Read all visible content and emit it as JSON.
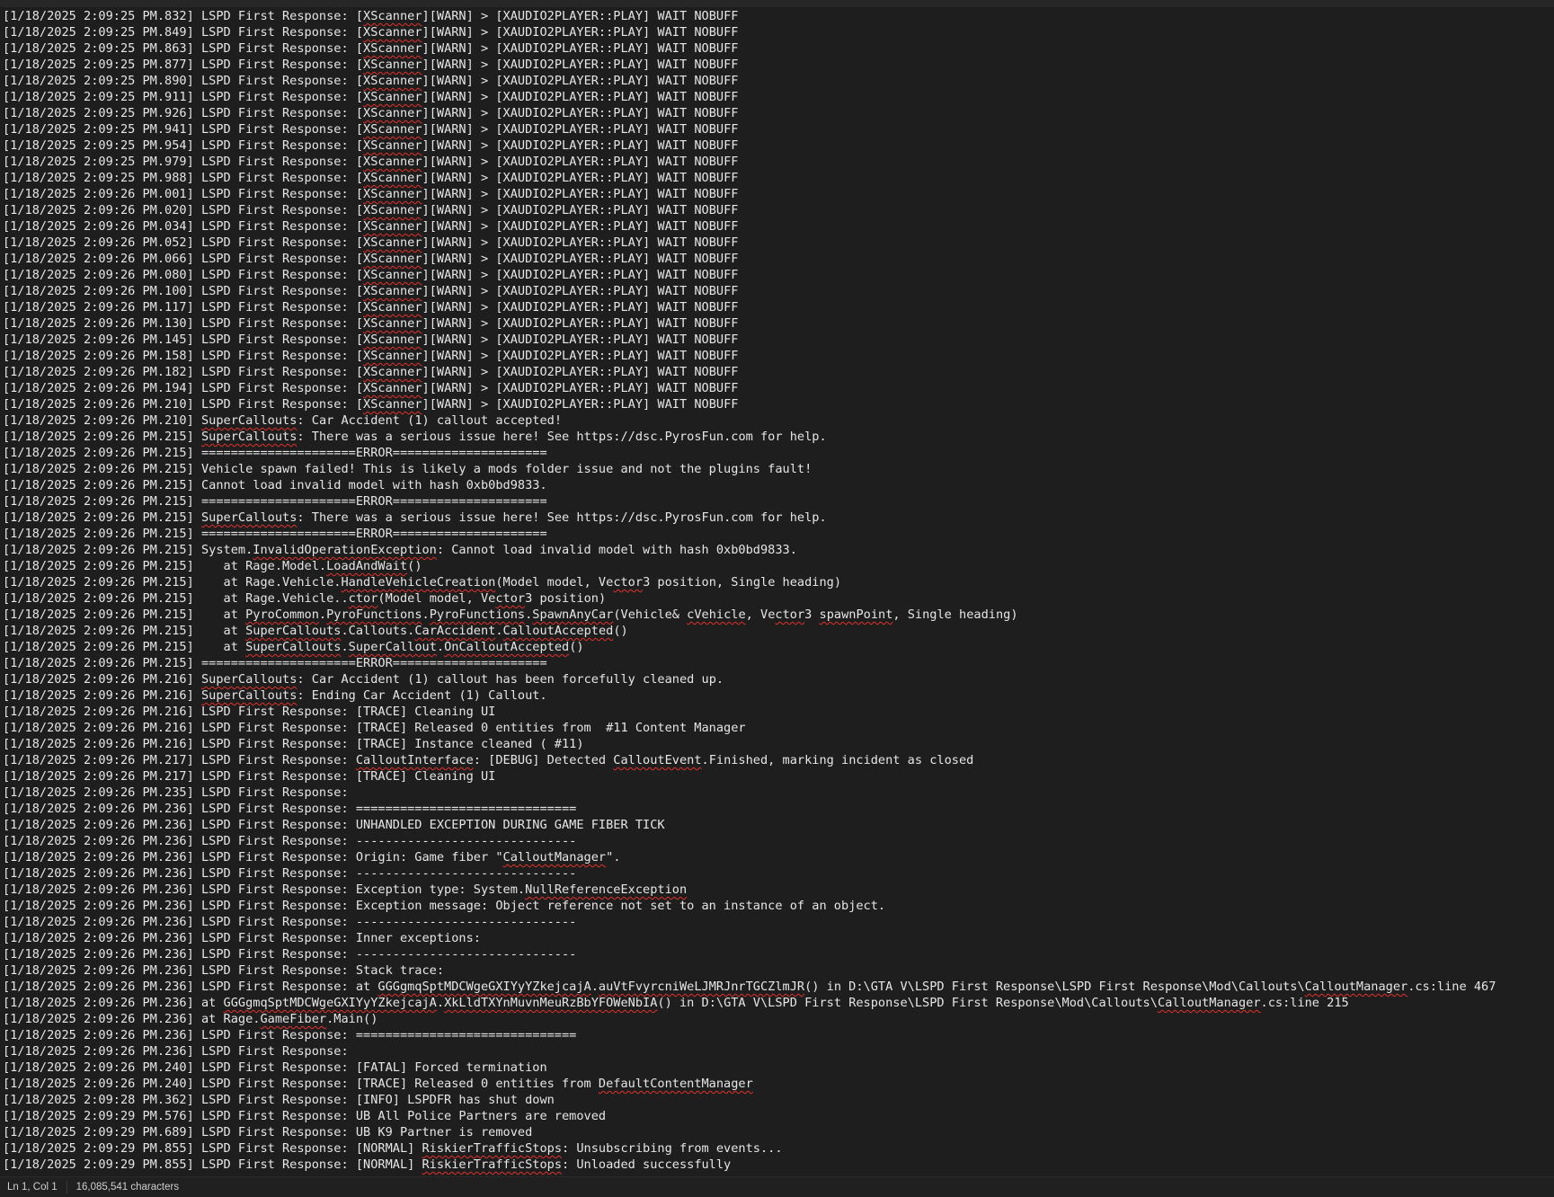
{
  "editor": {
    "lines": [
      "[1/18/2025 2:09:25 PM.832] LSPD First Response: [XScanner][WARN] > [XAUDIO2PLAYER::PLAY] WAIT NOBUFF",
      "[1/18/2025 2:09:25 PM.849] LSPD First Response: [XScanner][WARN] > [XAUDIO2PLAYER::PLAY] WAIT NOBUFF",
      "[1/18/2025 2:09:25 PM.863] LSPD First Response: [XScanner][WARN] > [XAUDIO2PLAYER::PLAY] WAIT NOBUFF",
      "[1/18/2025 2:09:25 PM.877] LSPD First Response: [XScanner][WARN] > [XAUDIO2PLAYER::PLAY] WAIT NOBUFF",
      "[1/18/2025 2:09:25 PM.890] LSPD First Response: [XScanner][WARN] > [XAUDIO2PLAYER::PLAY] WAIT NOBUFF",
      "[1/18/2025 2:09:25 PM.911] LSPD First Response: [XScanner][WARN] > [XAUDIO2PLAYER::PLAY] WAIT NOBUFF",
      "[1/18/2025 2:09:25 PM.926] LSPD First Response: [XScanner][WARN] > [XAUDIO2PLAYER::PLAY] WAIT NOBUFF",
      "[1/18/2025 2:09:25 PM.941] LSPD First Response: [XScanner][WARN] > [XAUDIO2PLAYER::PLAY] WAIT NOBUFF",
      "[1/18/2025 2:09:25 PM.954] LSPD First Response: [XScanner][WARN] > [XAUDIO2PLAYER::PLAY] WAIT NOBUFF",
      "[1/18/2025 2:09:25 PM.979] LSPD First Response: [XScanner][WARN] > [XAUDIO2PLAYER::PLAY] WAIT NOBUFF",
      "[1/18/2025 2:09:25 PM.988] LSPD First Response: [XScanner][WARN] > [XAUDIO2PLAYER::PLAY] WAIT NOBUFF",
      "[1/18/2025 2:09:26 PM.001] LSPD First Response: [XScanner][WARN] > [XAUDIO2PLAYER::PLAY] WAIT NOBUFF",
      "[1/18/2025 2:09:26 PM.020] LSPD First Response: [XScanner][WARN] > [XAUDIO2PLAYER::PLAY] WAIT NOBUFF",
      "[1/18/2025 2:09:26 PM.034] LSPD First Response: [XScanner][WARN] > [XAUDIO2PLAYER::PLAY] WAIT NOBUFF",
      "[1/18/2025 2:09:26 PM.052] LSPD First Response: [XScanner][WARN] > [XAUDIO2PLAYER::PLAY] WAIT NOBUFF",
      "[1/18/2025 2:09:26 PM.066] LSPD First Response: [XScanner][WARN] > [XAUDIO2PLAYER::PLAY] WAIT NOBUFF",
      "[1/18/2025 2:09:26 PM.080] LSPD First Response: [XScanner][WARN] > [XAUDIO2PLAYER::PLAY] WAIT NOBUFF",
      "[1/18/2025 2:09:26 PM.100] LSPD First Response: [XScanner][WARN] > [XAUDIO2PLAYER::PLAY] WAIT NOBUFF",
      "[1/18/2025 2:09:26 PM.117] LSPD First Response: [XScanner][WARN] > [XAUDIO2PLAYER::PLAY] WAIT NOBUFF",
      "[1/18/2025 2:09:26 PM.130] LSPD First Response: [XScanner][WARN] > [XAUDIO2PLAYER::PLAY] WAIT NOBUFF",
      "[1/18/2025 2:09:26 PM.145] LSPD First Response: [XScanner][WARN] > [XAUDIO2PLAYER::PLAY] WAIT NOBUFF",
      "[1/18/2025 2:09:26 PM.158] LSPD First Response: [XScanner][WARN] > [XAUDIO2PLAYER::PLAY] WAIT NOBUFF",
      "[1/18/2025 2:09:26 PM.182] LSPD First Response: [XScanner][WARN] > [XAUDIO2PLAYER::PLAY] WAIT NOBUFF",
      "[1/18/2025 2:09:26 PM.194] LSPD First Response: [XScanner][WARN] > [XAUDIO2PLAYER::PLAY] WAIT NOBUFF",
      "[1/18/2025 2:09:26 PM.210] LSPD First Response: [XScanner][WARN] > [XAUDIO2PLAYER::PLAY] WAIT NOBUFF",
      "[1/18/2025 2:09:26 PM.210] SuperCallouts: Car Accident (1) callout accepted!",
      "[1/18/2025 2:09:26 PM.215] SuperCallouts: There was a serious issue here! See https://dsc.PyrosFun.com for help.",
      "[1/18/2025 2:09:26 PM.215] =====================ERROR=====================",
      "[1/18/2025 2:09:26 PM.215] Vehicle spawn failed! This is likely a mods folder issue and not the plugins fault!",
      "[1/18/2025 2:09:26 PM.215] Cannot load invalid model with hash 0xb0bd9833.",
      "[1/18/2025 2:09:26 PM.215] =====================ERROR=====================",
      "[1/18/2025 2:09:26 PM.215] SuperCallouts: There was a serious issue here! See https://dsc.PyrosFun.com for help.",
      "[1/18/2025 2:09:26 PM.215] =====================ERROR=====================",
      "[1/18/2025 2:09:26 PM.215] System.InvalidOperationException: Cannot load invalid model with hash 0xb0bd9833.",
      "[1/18/2025 2:09:26 PM.215]    at Rage.Model.LoadAndWait()",
      "[1/18/2025 2:09:26 PM.215]    at Rage.Vehicle.HandleVehicleCreation(Model model, Vector3 position, Single heading)",
      "[1/18/2025 2:09:26 PM.215]    at Rage.Vehicle..ctor(Model model, Vector3 position)",
      "[1/18/2025 2:09:26 PM.215]    at PyroCommon.PyroFunctions.PyroFunctions.SpawnAnyCar(Vehicle& cVehicle, Vector3 spawnPoint, Single heading)",
      "[1/18/2025 2:09:26 PM.215]    at SuperCallouts.Callouts.CarAccident.CalloutAccepted()",
      "[1/18/2025 2:09:26 PM.215]    at SuperCallouts.SuperCallout.OnCalloutAccepted()",
      "[1/18/2025 2:09:26 PM.215] =====================ERROR=====================",
      "[1/18/2025 2:09:26 PM.216] SuperCallouts: Car Accident (1) callout has been forcefully cleaned up.",
      "[1/18/2025 2:09:26 PM.216] SuperCallouts: Ending Car Accident (1) Callout.",
      "[1/18/2025 2:09:26 PM.216] LSPD First Response: [TRACE] Cleaning UI",
      "[1/18/2025 2:09:26 PM.216] LSPD First Response: [TRACE] Released 0 entities from  #11 Content Manager",
      "[1/18/2025 2:09:26 PM.216] LSPD First Response: [TRACE] Instance cleaned ( #11)",
      "[1/18/2025 2:09:26 PM.217] LSPD First Response: CalloutInterface: [DEBUG] Detected CalloutEvent.Finished, marking incident as closed",
      "[1/18/2025 2:09:26 PM.217] LSPD First Response: [TRACE] Cleaning UI",
      "[1/18/2025 2:09:26 PM.235] LSPD First Response:",
      "[1/18/2025 2:09:26 PM.236] LSPD First Response: ==============================",
      "[1/18/2025 2:09:26 PM.236] LSPD First Response: UNHANDLED EXCEPTION DURING GAME FIBER TICK",
      "[1/18/2025 2:09:26 PM.236] LSPD First Response: ------------------------------",
      "[1/18/2025 2:09:26 PM.236] LSPD First Response: Origin: Game fiber \"CalloutManager\".",
      "[1/18/2025 2:09:26 PM.236] LSPD First Response: ------------------------------",
      "[1/18/2025 2:09:26 PM.236] LSPD First Response: Exception type: System.NullReferenceException",
      "[1/18/2025 2:09:26 PM.236] LSPD First Response: Exception message: Object reference not set to an instance of an object.",
      "[1/18/2025 2:09:26 PM.236] LSPD First Response: ------------------------------",
      "[1/18/2025 2:09:26 PM.236] LSPD First Response: Inner exceptions:",
      "[1/18/2025 2:09:26 PM.236] LSPD First Response: ------------------------------",
      "[1/18/2025 2:09:26 PM.236] LSPD First Response: Stack trace:",
      "[1/18/2025 2:09:26 PM.236] LSPD First Response: at GGGgmqSptMDCWgeGXIYyYZkejcajA.auVtFvyrcniWeLJMRJnrTGCZlmJR() in D:\\GTA V\\LSPD First Response\\LSPD First Response\\Mod\\Callouts\\CalloutManager.cs:line 467",
      "[1/18/2025 2:09:26 PM.236] at GGGgmqSptMDCWgeGXIYyYZkejcajA.XkLldTXYnMuvnMeuRzBbYFOWeNbIA() in D:\\GTA V\\LSPD First Response\\LSPD First Response\\Mod\\Callouts\\CalloutManager.cs:line 215",
      "[1/18/2025 2:09:26 PM.236] at Rage.GameFiber.Main()",
      "[1/18/2025 2:09:26 PM.236] LSPD First Response: ==============================",
      "[1/18/2025 2:09:26 PM.236] LSPD First Response:",
      "[1/18/2025 2:09:26 PM.240] LSPD First Response: [FATAL] Forced termination",
      "[1/18/2025 2:09:26 PM.240] LSPD First Response: [TRACE] Released 0 entities from DefaultContentManager",
      "[1/18/2025 2:09:28 PM.362] LSPD First Response: [INFO] LSPDFR has shut down",
      "[1/18/2025 2:09:29 PM.576] LSPD First Response: UB All Police Partners are removed",
      "[1/18/2025 2:09:29 PM.689] LSPD First Response: UB K9 Partner is removed",
      "[1/18/2025 2:09:29 PM.855] LSPD First Response: [NORMAL] RiskierTrafficStops: Unsubscribing from events...",
      "[1/18/2025 2:09:29 PM.855] LSPD First Response: [NORMAL] RiskierTrafficStops: Unloaded successfully"
    ],
    "spellcheck_words": [
      "XScanner",
      "SuperCallouts",
      "InvalidOperationException",
      "LoadAndWait",
      "HandleVehicleCreation",
      "ctor",
      "PyroCommon",
      "PyroFunctions",
      "SpawnAnyCar",
      "cVehicle",
      "spawnPoint",
      "CarAccident",
      "CalloutAccepted",
      "SuperCallout",
      "OnCalloutAccepted",
      "CalloutInterface",
      "CalloutEvent",
      "CalloutManager",
      "NullReferenceException",
      "GGGgmqSptMDCWgeGXIYyYZkejcajA",
      "auVtFvyrcniWeLJMRJnrTGCZlmJR",
      "XkLldTXYnMuvnMeuRzBbYFOWeNbIA",
      "GameFiber",
      "DefaultContentManager",
      "RiskierTrafficStops"
    ],
    "squiggle_color": "#e0312b",
    "text_color": "#e6e6e6",
    "background_color": "#1e1e1e"
  },
  "statusbar": {
    "cursor_position": "Ln 1, Col 1",
    "character_count": "16,085,541 characters"
  }
}
